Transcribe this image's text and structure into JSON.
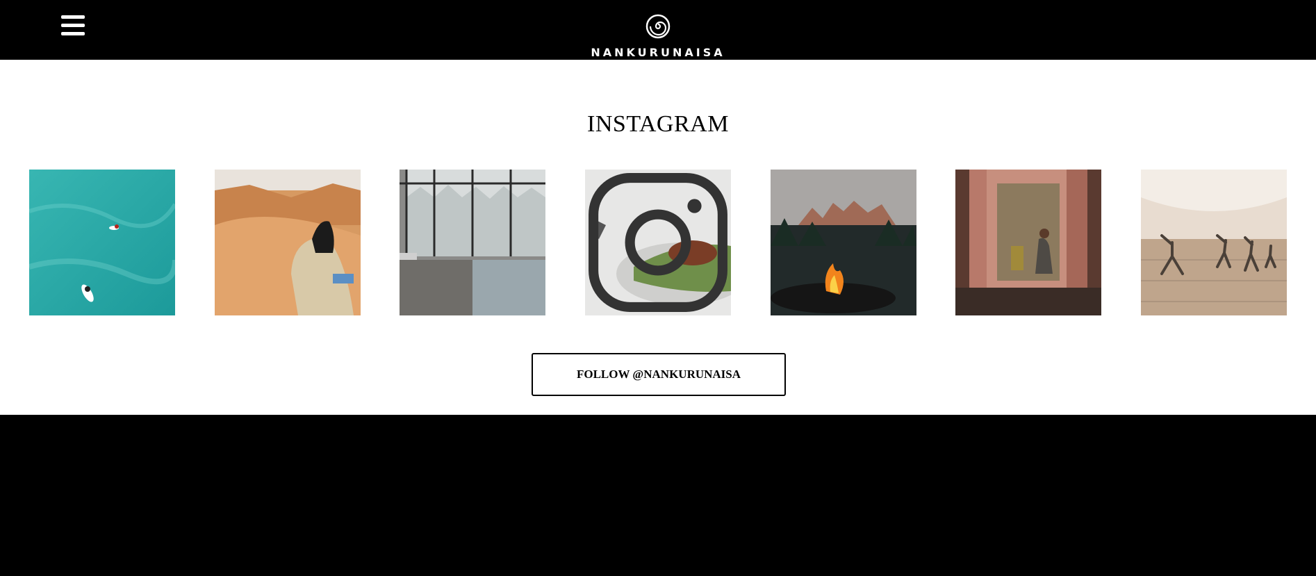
{
  "header": {
    "brand": "NANKURUNAISA",
    "menu_icon": "hamburger-menu-icon",
    "logo_icon": "spiral-logo-icon",
    "background": "#000000",
    "foreground": "#ffffff"
  },
  "instagram": {
    "title": "INSTAGRAM",
    "follow_label": "FOLLOW @NANKURUNAISA",
    "hover_icon": "instagram-icon",
    "posts": [
      {
        "subject": "surfers-in-turquoise-sea"
      },
      {
        "subject": "desert-nomad-on-dunes"
      },
      {
        "subject": "indoor-pool-snowy-forest"
      },
      {
        "subject": "smoked-dish-with-herbs"
      },
      {
        "subject": "campfire-mountain-view"
      },
      {
        "subject": "woman-in-alcove"
      },
      {
        "subject": "outdoor-yoga-terrace"
      }
    ]
  }
}
